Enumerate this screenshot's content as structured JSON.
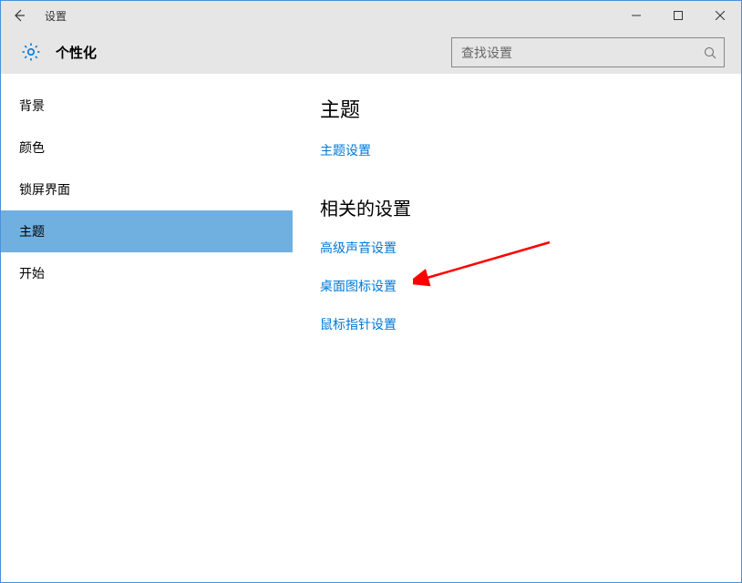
{
  "window": {
    "title": "设置"
  },
  "header": {
    "title": "个性化",
    "search_placeholder": "查找设置"
  },
  "sidebar": {
    "items": [
      {
        "label": "背景",
        "selected": false
      },
      {
        "label": "颜色",
        "selected": false
      },
      {
        "label": "锁屏界面",
        "selected": false
      },
      {
        "label": "主题",
        "selected": true
      },
      {
        "label": "开始",
        "selected": false
      }
    ]
  },
  "main": {
    "heading1": "主题",
    "link1": "主题设置",
    "heading2": "相关的设置",
    "link2": "高级声音设置",
    "link3": "桌面图标设置",
    "link4": "鼠标指针设置"
  }
}
